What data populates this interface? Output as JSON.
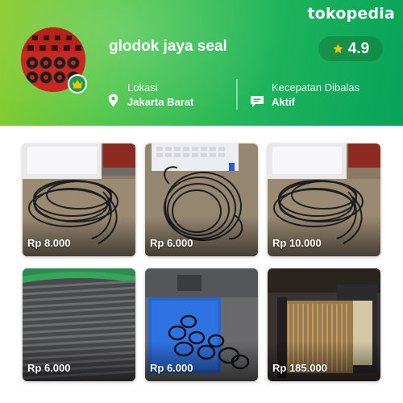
{
  "brand": {
    "logo_text": "tokopedia"
  },
  "shop": {
    "name": "glodok jaya seal",
    "rating": "4.9",
    "location_label": "Lokasi",
    "location_value": "Jakarta Barat",
    "response_label": "Kecepatan Dibalas",
    "response_value": "Aktif"
  },
  "products": [
    {
      "price": "Rp 8.000"
    },
    {
      "price": "Rp 6.000"
    },
    {
      "price": "Rp 10.000"
    },
    {
      "price": "Rp 6.000"
    },
    {
      "price": "Rp 6.000"
    },
    {
      "price": "Rp 185.000"
    }
  ],
  "colors": {
    "header_green": "#07a35a",
    "header_lime": "#8ccc2e",
    "star": "#f6c200",
    "badge": "#1f9a4f"
  },
  "icons": [
    "location-pin-icon",
    "chat-bubble-icon",
    "star-icon",
    "crown-icon"
  ]
}
